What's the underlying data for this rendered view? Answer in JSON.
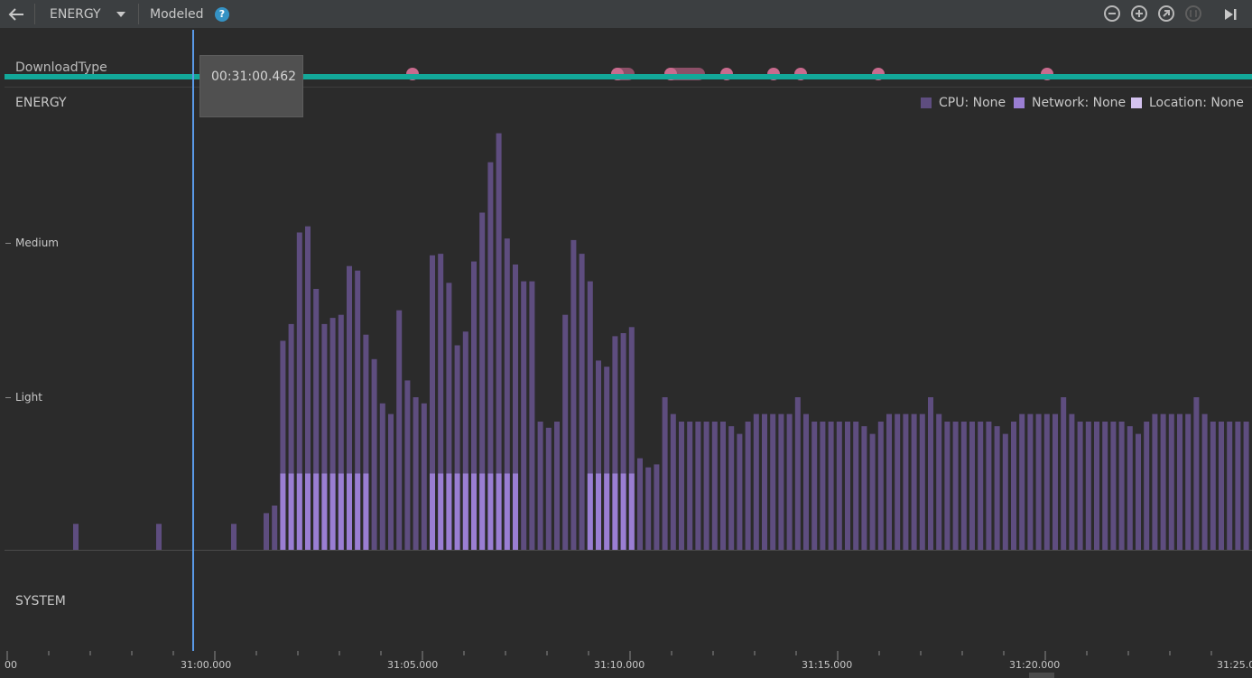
{
  "toolbar": {
    "back_icon": "arrow-left-icon",
    "profiler_select": "ENERGY",
    "dropdown_icon": "caret-down-icon",
    "mode_label": "Modeled",
    "help_glyph": "?",
    "zoom_out_icon": "minus-icon",
    "zoom_in_icon": "plus-icon",
    "reset_zoom_icon": "reset-zoom-icon",
    "zoom_to_selection_icon": "zoom-selection-icon",
    "go_live_icon": "skip-to-end-icon"
  },
  "events_track": {
    "label": "DownloadType"
  },
  "tooltip": {
    "time": "00:31:00.462"
  },
  "energy": {
    "label": "ENERGY",
    "levels": [
      "Medium",
      "Light"
    ]
  },
  "legend": [
    {
      "label": "CPU: None",
      "color": "#5e4d7f"
    },
    {
      "label": "Network: None",
      "color": "#9a7ed3"
    },
    {
      "label": "Location: None",
      "color": "#d4c2ef"
    }
  ],
  "system": {
    "label": "SYSTEM"
  },
  "axis_labels": [
    "00",
    "31:00.000",
    "31:05.000",
    "31:10.000",
    "31:15.000",
    "31:20.000",
    "31:25.0"
  ],
  "colors": {
    "cpu": "#5e4d7f",
    "network": "#9a7ed3",
    "event_dot": "#c86b8e",
    "event_track": "#13a899",
    "cursor": "#5a9ae8"
  },
  "chart_data": {
    "type": "bar",
    "x_start": "31:00.000",
    "x_step_seconds": 0.2,
    "levels": {
      "Light": 1,
      "Medium": 2
    },
    "series": [
      {
        "name": "CPU: None",
        "values": [
          0.24,
          0.29,
          1.37,
          1.48,
          2.08,
          2.12,
          1.71,
          1.48,
          1.52,
          1.54,
          1.86,
          1.83,
          1.41,
          1.25,
          0.96,
          0.89,
          1.57,
          1.11,
          1.0,
          0.96,
          1.93,
          1.94,
          1.75,
          1.34,
          1.43,
          1.89,
          2.21,
          2.54,
          2.73,
          2.04,
          1.87,
          1.76,
          1.76,
          0.84,
          0.8,
          0.84,
          1.54,
          2.03,
          1.94,
          1.76,
          1.24,
          1.2,
          1.4,
          1.42,
          1.46,
          0.6,
          0.54,
          0.56,
          1.0,
          0.89,
          0.84,
          0.84,
          0.84,
          0.84,
          0.84,
          0.84,
          0.81,
          0.76,
          0.84,
          0.89,
          0.89,
          0.89,
          0.89,
          0.89
        ]
      },
      {
        "name": "Network: None",
        "values": [
          0,
          0,
          0.5,
          0.5,
          0.5,
          0.5,
          0.5,
          0.5,
          0.5,
          0.5,
          0.5,
          0.5,
          0.5,
          0,
          0,
          0,
          0,
          0,
          0,
          0,
          0.5,
          0.5,
          0.5,
          0.5,
          0.5,
          0.5,
          0.5,
          0.5,
          0.5,
          0.5,
          0.5,
          0,
          0,
          0,
          0,
          0,
          0,
          0,
          0,
          0.5,
          0.5,
          0.5,
          0.5,
          0.5,
          0.5,
          0,
          0,
          0,
          0,
          0,
          0,
          0,
          0,
          0,
          0,
          0,
          0,
          0,
          0,
          0,
          0,
          0,
          0,
          0,
          0
        ]
      }
    ]
  }
}
